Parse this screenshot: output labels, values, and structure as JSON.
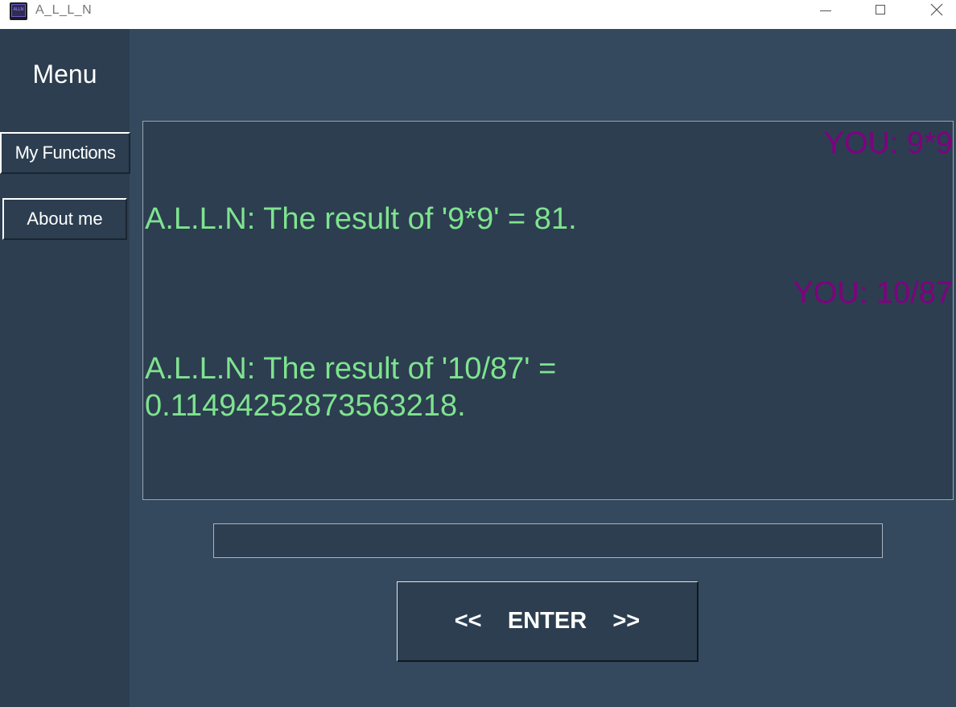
{
  "window": {
    "title": "A_L_L_N",
    "icon_text": "ALLN",
    "controls": {
      "minimize_icon": "minimize-icon",
      "maximize_icon": "maximize-icon",
      "close_icon": "close-icon"
    }
  },
  "colors": {
    "background": "#34495e",
    "panel": "#2c3e50",
    "user_text": "#800080",
    "bot_text": "#7fe38f",
    "label_text": "#ffffff"
  },
  "sidebar": {
    "title": "Menu",
    "buttons": [
      {
        "label": "My Functions"
      },
      {
        "label": "About me"
      }
    ]
  },
  "chat": {
    "messages": [
      {
        "sender": "user",
        "text": "YOU: 9*9"
      },
      {
        "sender": "bot",
        "lines": [
          "A.L.L.N: The result of '9*9' = 81."
        ]
      },
      {
        "sender": "user",
        "text": "YOU: 10/87"
      },
      {
        "sender": "bot",
        "lines": [
          "A.L.L.N: The result of '10/87' =",
          "0.11494252873563218."
        ]
      }
    ]
  },
  "input": {
    "value": "",
    "placeholder": ""
  },
  "enter_button": {
    "label": "<<    ENTER    >>"
  }
}
